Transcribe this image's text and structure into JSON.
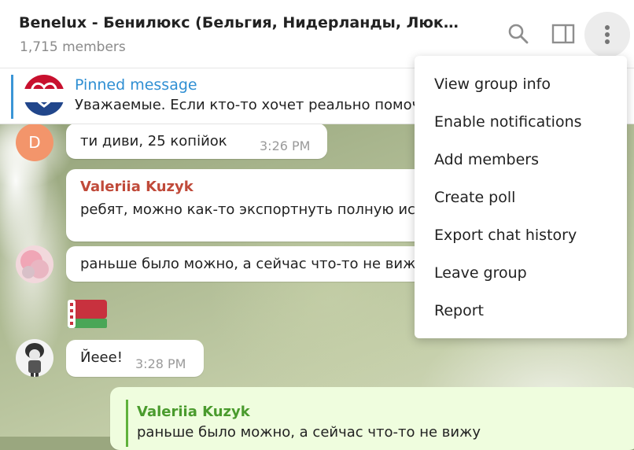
{
  "header": {
    "title": "Benelux - Бенилюкс (Бельгия, Нидерланды, Люксембур...",
    "subtitle": "1,715 members",
    "icons": [
      "search-icon",
      "sidebar-toggle-icon",
      "more-vertical-icon"
    ]
  },
  "pinned": {
    "title": "Pinned message",
    "text": "Уважаемые. Если кто-то хочет реально помочь"
  },
  "messages": [
    {
      "avatar_letter": "D",
      "text": "ти диви, 25 копійок",
      "time": "3:26 PM"
    },
    {
      "sender": "Valeriia Kuzyk",
      "text": "ребят, можно как-то экспортнуть полную историю"
    },
    {
      "text": "раньше было можно, а сейчас что-то не вижу"
    },
    {
      "text": "Йеее!",
      "time": "3:28 PM"
    }
  ],
  "reply": {
    "name": "Valeriia Kuzyk",
    "text": "раньше было можно, а сейчас что-то не вижу"
  },
  "menu": {
    "items": [
      {
        "label": "View group info"
      },
      {
        "label": "Enable notifications"
      },
      {
        "label": "Add members"
      },
      {
        "label": "Create poll"
      },
      {
        "label": "Export chat history"
      },
      {
        "label": "Leave group"
      },
      {
        "label": "Report"
      }
    ]
  },
  "colors": {
    "accent": "#2f8fd3",
    "sender_name": "#c04a3a",
    "reply_name": "#4a9b2d",
    "outgoing_bubble": "#effdde"
  }
}
